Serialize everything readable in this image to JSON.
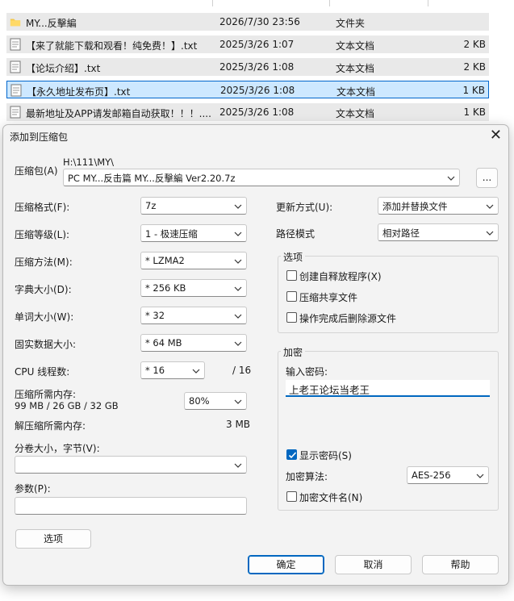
{
  "file_list": {
    "rows": [
      {
        "icon": "folder-icon",
        "name": "MY...反擊編",
        "date": "2026/7/30 23:56",
        "type": "文件夹",
        "size": ""
      },
      {
        "icon": "text-file-icon",
        "name": "【来了就能下载和观看！纯免费！】.txt",
        "date": "2025/3/26 1:07",
        "type": "文本文档",
        "size": "2 KB"
      },
      {
        "icon": "text-file-icon",
        "name": "【论坛介绍】.txt",
        "date": "2025/3/26 1:08",
        "type": "文本文档",
        "size": "2 KB"
      },
      {
        "icon": "text-file-icon",
        "name": "【永久地址发布页】.txt",
        "date": "2025/3/26 1:08",
        "type": "文本文档",
        "size": "1 KB"
      },
      {
        "icon": "text-file-icon",
        "name": "最新地址及APP请发邮箱自动获取！！！....",
        "date": "2025/3/26 1:08",
        "type": "文本文档",
        "size": "1 KB"
      }
    ]
  },
  "dialog": {
    "title": "添加到压缩包",
    "archive_label": "压缩包(A)",
    "archive_path": "H:\\111\\MY\\",
    "archive_name": "PC MY...反击篇 MY...反擊編 Ver2.20.7z",
    "browse_label": "...",
    "format_label": "压缩格式(F):",
    "format_value": "7z",
    "level_label": "压缩等级(L):",
    "level_value": "1 - 极速压缩",
    "method_label": "压缩方法(M):",
    "method_value": "*  LZMA2",
    "dict_label": "字典大小(D):",
    "dict_value": "*  256 KB",
    "word_label": "单词大小(W):",
    "word_value": "*  32",
    "solid_label": "固实数据大小:",
    "solid_value": "*  64 MB",
    "cpu_label": "CPU 线程数:",
    "cpu_value": "*  16",
    "cpu_total": "/ 16",
    "mem_comp_label": "压缩所需内存:",
    "mem_comp_detail": "99 MB / 26 GB / 32 GB",
    "mem_comp_value": "80%",
    "mem_decomp_label": "解压缩所需内存:",
    "mem_decomp_value": "3 MB",
    "split_label": "分卷大小，字节(V):",
    "split_value": "",
    "params_label": "参数(P):",
    "params_value": "",
    "options_button": "选项",
    "update_label": "更新方式(U):",
    "update_value": "添加并替换文件",
    "path_label": "路径模式",
    "path_value": "相对路径",
    "options_group": {
      "title": "选项",
      "items": [
        {
          "label": "创建自释放程序(X)",
          "checked": false
        },
        {
          "label": "压缩共享文件",
          "checked": false
        },
        {
          "label": "操作完成后删除源文件",
          "checked": false
        }
      ]
    },
    "encryption_group": {
      "title": "加密",
      "password_label": "输入密码:",
      "password_value": "上老王论坛当老王",
      "show_password_label": "显示密码(S)",
      "show_password_checked": true,
      "method_label": "加密算法:",
      "method_value": "AES-256",
      "encrypt_names_label": "加密文件名(N)",
      "encrypt_names_checked": false
    },
    "ok_button": "确定",
    "cancel_button": "取消",
    "help_button": "帮助"
  },
  "colors": {
    "accent": "#0067c0",
    "selection": "#cde8ff",
    "row_bg": "#e9e9e9"
  }
}
